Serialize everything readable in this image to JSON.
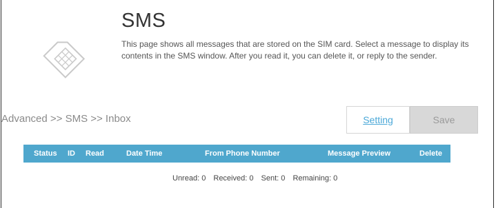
{
  "header": {
    "title": "SMS",
    "description": "This page shows all messages that are stored on the SIM card. Select a message to display its contents in the SMS window. After you read it, you can delete it, or reply to the sender."
  },
  "icon": "sim-card-icon",
  "breadcrumb": "Advanced >> SMS >> Inbox",
  "buttons": {
    "setting": "Setting",
    "save": "Save"
  },
  "table": {
    "columns": [
      "Status",
      "ID",
      "Read",
      "Date Time",
      "From Phone Number",
      "Message Preview",
      "Delete"
    ],
    "rows": []
  },
  "counts": {
    "unread": "Unread: 0",
    "received": "Received: 0",
    "sent": "Sent: 0",
    "remaining": "Remaining: 0"
  },
  "colors": {
    "table_header": "#4fa7cd",
    "link": "#4aa8d8",
    "disabled_button": "#d8d8d8"
  }
}
